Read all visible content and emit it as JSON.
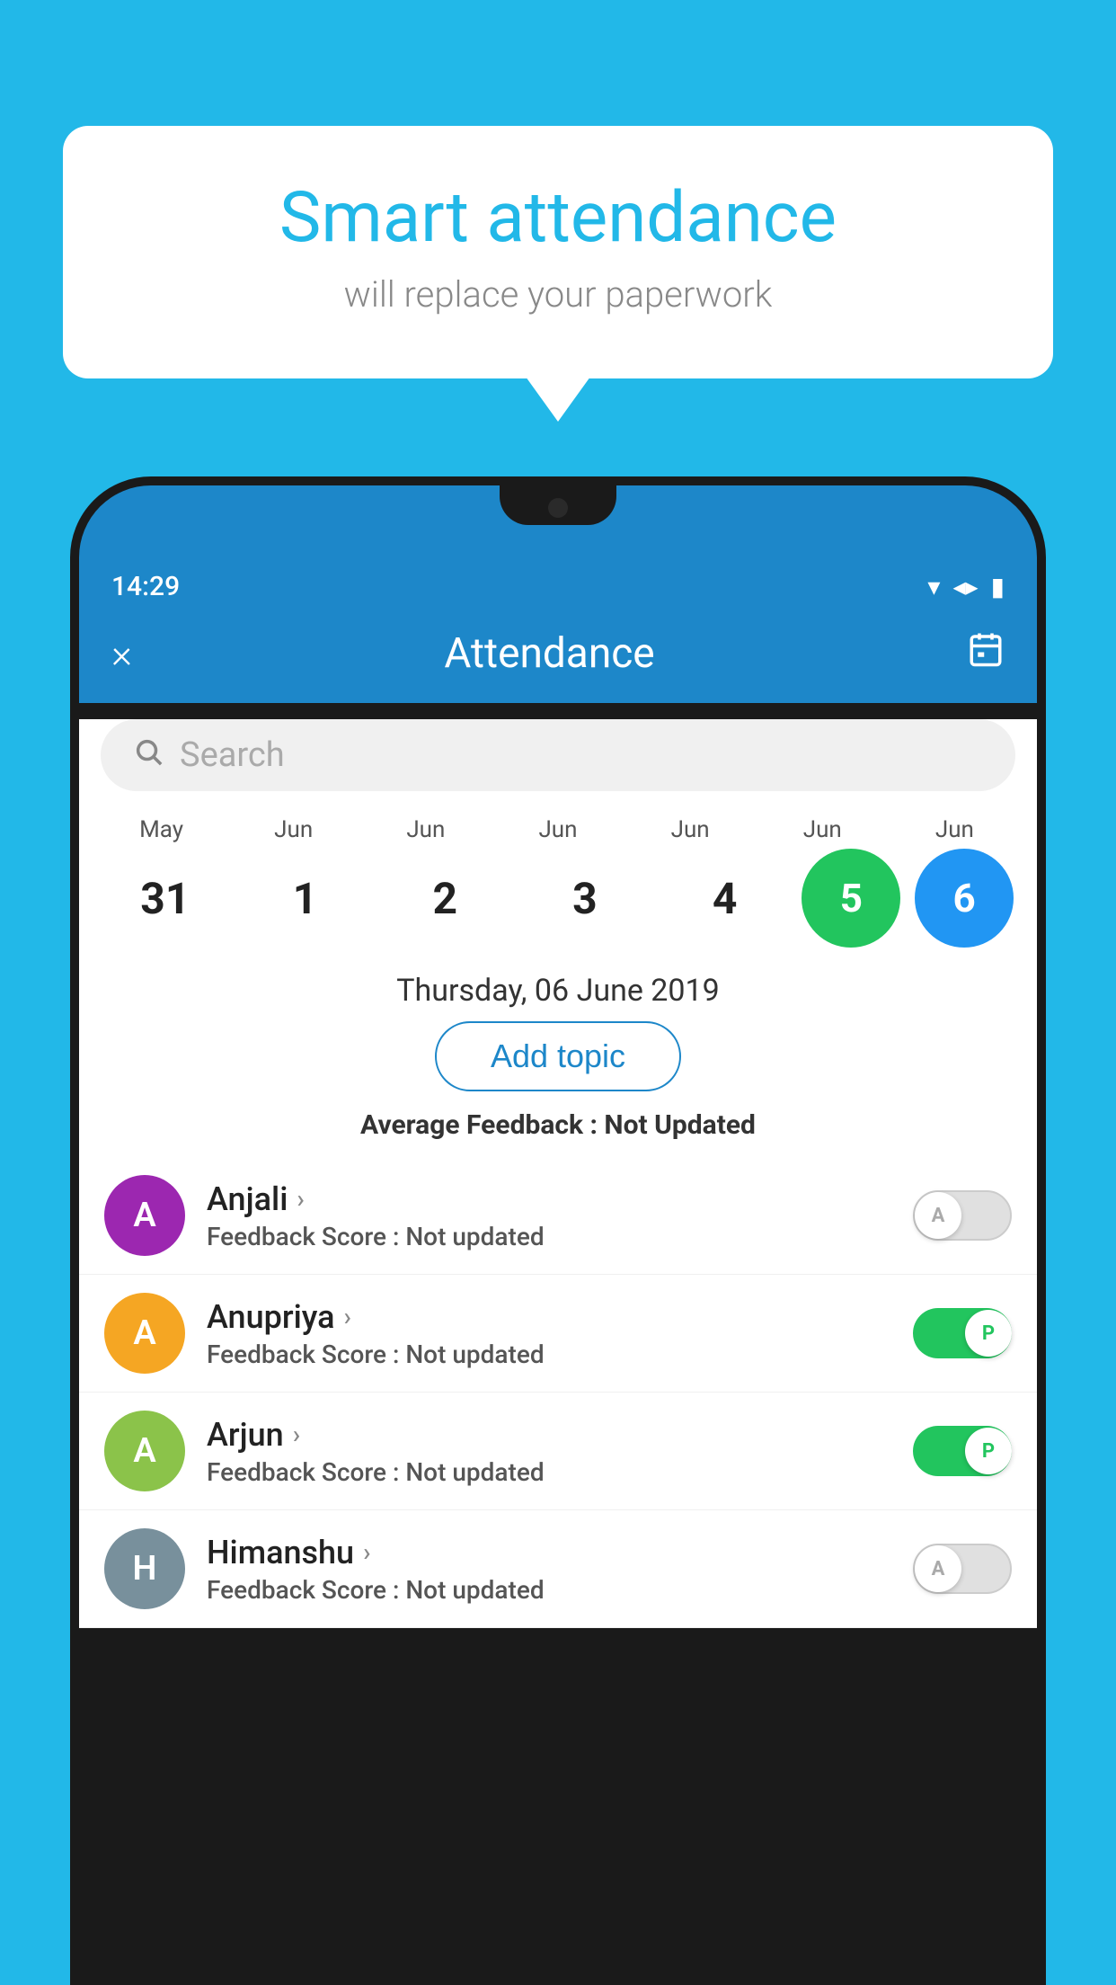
{
  "background_color": "#22b8e8",
  "speech_bubble": {
    "title": "Smart attendance",
    "subtitle": "will replace your paperwork"
  },
  "status_bar": {
    "time": "14:29",
    "wifi_icon": "▼",
    "signal_icon": "▲",
    "battery_icon": "▮"
  },
  "header": {
    "close_label": "×",
    "title": "Attendance",
    "calendar_icon": "📅"
  },
  "search": {
    "placeholder": "Search"
  },
  "calendar": {
    "months": [
      "May",
      "Jun",
      "Jun",
      "Jun",
      "Jun",
      "Jun",
      "Jun"
    ],
    "dates": [
      "31",
      "1",
      "2",
      "3",
      "4",
      "5",
      "6"
    ],
    "selected_date_index": 5,
    "today_index": 6
  },
  "selected_date_label": "Thursday, 06 June 2019",
  "add_topic_label": "Add topic",
  "avg_feedback_label": "Average Feedback : ",
  "avg_feedback_value": "Not Updated",
  "students": [
    {
      "name": "Anjali",
      "initial": "A",
      "avatar_color": "#9c27b0",
      "feedback_label": "Feedback Score : ",
      "feedback_value": "Not updated",
      "toggle_state": "off",
      "toggle_label": "A"
    },
    {
      "name": "Anupriya",
      "initial": "A",
      "avatar_color": "#f5a623",
      "feedback_label": "Feedback Score : ",
      "feedback_value": "Not updated",
      "toggle_state": "on",
      "toggle_label": "P"
    },
    {
      "name": "Arjun",
      "initial": "A",
      "avatar_color": "#8bc34a",
      "feedback_label": "Feedback Score : ",
      "feedback_value": "Not updated",
      "toggle_state": "on",
      "toggle_label": "P"
    },
    {
      "name": "Himanshu",
      "initial": "H",
      "avatar_color": "#78909c",
      "feedback_label": "Feedback Score : ",
      "feedback_value": "Not updated",
      "toggle_state": "off",
      "toggle_label": "A"
    }
  ]
}
